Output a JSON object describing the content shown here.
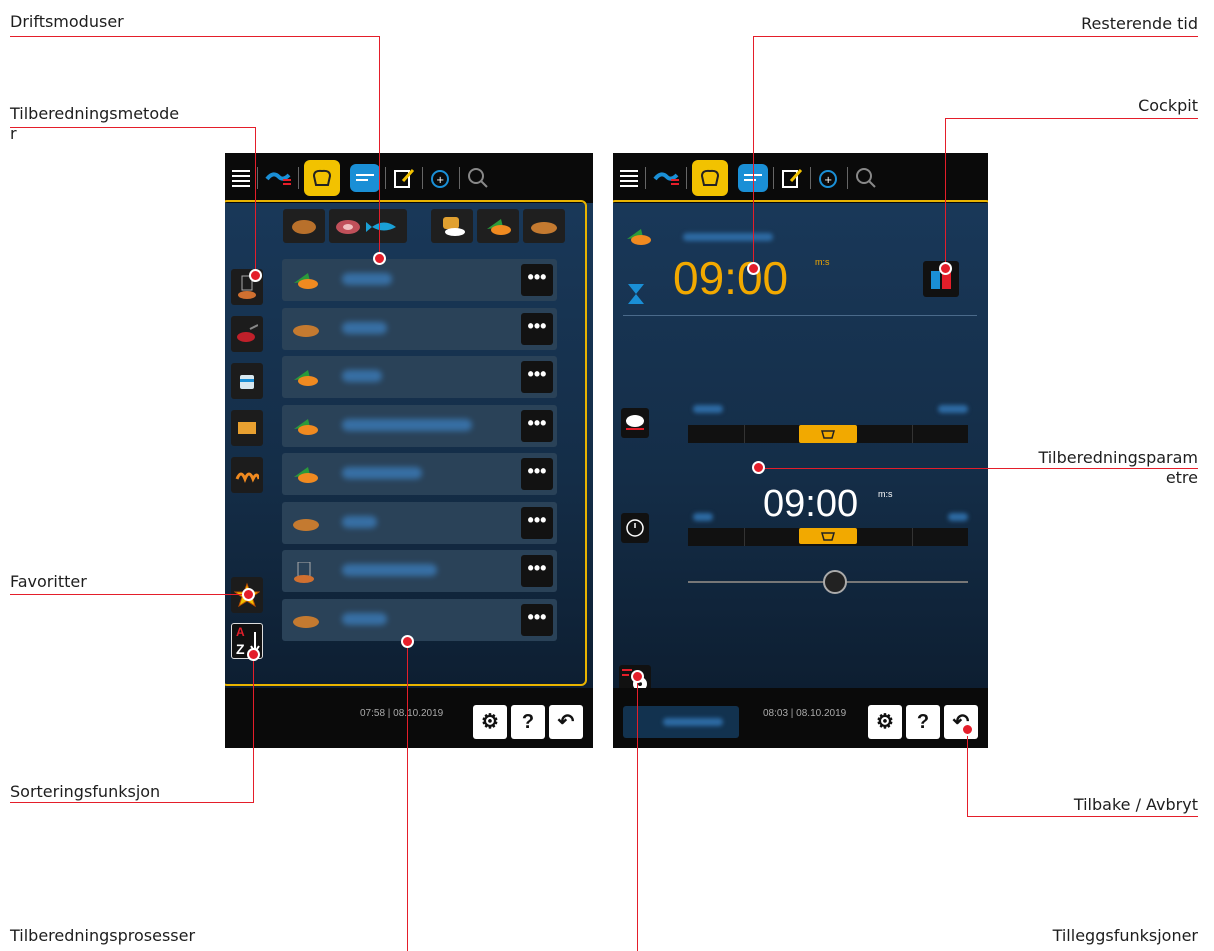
{
  "callouts": {
    "driftsmoduser": "Driftsmoduser",
    "tilberedningsmetoder_1": "Tilberedningsmetode",
    "tilberedningsmetoder_2": "r",
    "favoritter": "Favoritter",
    "sorteringsfunksjon": "Sorteringsfunksjon",
    "tilberedningsprosesser": "Tilberedningsprosesser",
    "resterende_tid": "Resterende tid",
    "cockpit": "Cockpit",
    "tilberedningsparametre_1": "Tilberedningsparam",
    "tilberedningsparametre_2": "etre",
    "tilbake_avbryt": "Tilbake / Avbryt",
    "tilleggsfunksjoner": "Tilleggsfunksjoner"
  },
  "left_screen": {
    "sort_icon_letters": {
      "a": "A",
      "z": "Z"
    },
    "process_rows": [
      {
        "food": "vegetables-icon"
      },
      {
        "food": "bread-icon"
      },
      {
        "food": "vegetables-icon"
      },
      {
        "food": "vegetables-icon"
      },
      {
        "food": "vegetables-icon"
      },
      {
        "food": "bread-icon"
      },
      {
        "food": "rack-icon"
      },
      {
        "food": "bread-icon"
      }
    ],
    "more_label": "•••",
    "clock": "07:58 | 08.10.2019",
    "settings_label": "⚙",
    "help_label": "?",
    "back_label": "↶"
  },
  "right_screen": {
    "remaining_time": "09:00",
    "remaining_unit": "m:s",
    "param_time": "09:00",
    "param_unit": "m:s",
    "clock": "08:03 | 08.10.2019",
    "settings_label": "⚙",
    "help_label": "?",
    "back_label": "↶"
  },
  "colors": {
    "accent": "#f2a900",
    "callout_line": "#e41e2a",
    "tab_active": "#f2c200"
  }
}
